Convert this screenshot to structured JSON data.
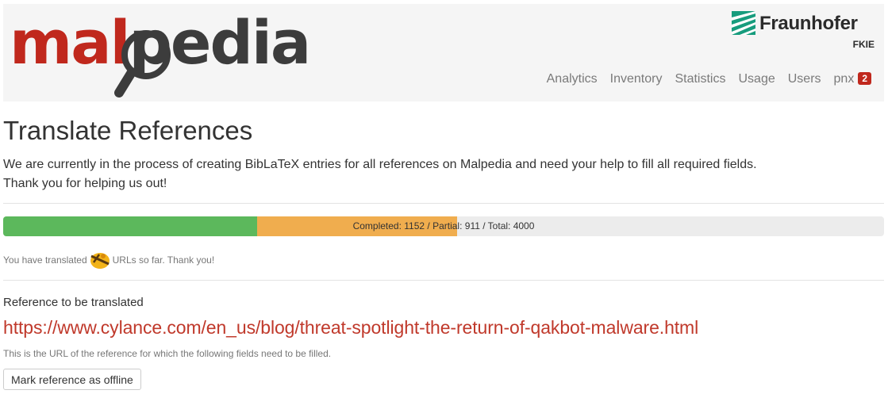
{
  "logo": {
    "part1": "mal",
    "part2": "pedia"
  },
  "partner": {
    "name": "Fraunhofer",
    "unit": "FKIE"
  },
  "nav": {
    "items": [
      "Analytics",
      "Inventory",
      "Statistics",
      "Usage",
      "Users"
    ],
    "user": "pnx",
    "badge": "2"
  },
  "page": {
    "title": "Translate References",
    "intro_line1": "We are currently in the process of creating BibLaTeX entries for all references on Malpedia and need your help to fill all required fields.",
    "intro_line2": "Thank you for helping us out!"
  },
  "progress": {
    "completed": 1152,
    "partial": 911,
    "total": 4000,
    "label": "Completed: 1152 / Partial: 911 / Total: 4000"
  },
  "thanks": {
    "before": "You have translated",
    "after": "URLs so far. Thank you!"
  },
  "reference": {
    "heading": "Reference to be translated",
    "url": "https://www.cylance.com/en_us/blog/threat-spotlight-the-return-of-qakbot-malware.html",
    "help": "This is the URL of the reference for which the following fields need to be filled.",
    "offline_button": "Mark reference as offline"
  },
  "colors": {
    "accent": "#c0281d",
    "completed": "#5cb85c",
    "partial": "#f0ad4e",
    "link": "#c0392b"
  }
}
